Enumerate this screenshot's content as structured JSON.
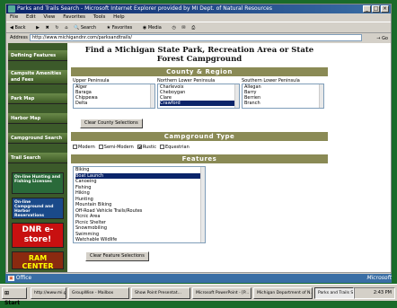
{
  "window": {
    "title": "Parks and Trails Search - Microsoft Internet Explorer provided by MI Dept. of Natural Resources"
  },
  "menu": [
    "File",
    "Edit",
    "View",
    "Favorites",
    "Tools",
    "Help"
  ],
  "toolbar": {
    "back": "Back",
    "search": "Search",
    "favorites": "Favorites",
    "media": "Media"
  },
  "address": {
    "label": "Address",
    "url": "http://www.michigandnr.com/parksandtrails/",
    "go": "Go"
  },
  "sidebar": {
    "items": [
      {
        "label": "Defining Features"
      },
      {
        "label": "Campsite Amenities and Fees"
      },
      {
        "label": "Park Map"
      },
      {
        "label": "Harbor Map"
      },
      {
        "label": "Campground Search"
      },
      {
        "label": "Trail Search"
      }
    ],
    "promos": [
      {
        "label": "On-line Hunting and Fishing Licenses"
      },
      {
        "label": "On-line Campground and Harbor Reservations"
      },
      {
        "label": "DNR e-store!"
      },
      {
        "label": "RAM CENTER"
      }
    ]
  },
  "main": {
    "title": "Find a Michigan State Park, Recreation Area or State Forest Campground",
    "county_header": "County & Region",
    "columns": [
      {
        "header": "Upper Peninsula",
        "items": [
          "Alger",
          "Baraga",
          "Chippewa",
          "Delta"
        ],
        "selected": -1
      },
      {
        "header": "Northern Lower Peninsula",
        "items": [
          "Charlevoix",
          "Cheboygan",
          "Clare",
          "Crawford"
        ],
        "selected": 3
      },
      {
        "header": "Southern Lower Peninsula",
        "items": [
          "Allegan",
          "Barry",
          "Berrien",
          "Branch"
        ],
        "selected": -1
      }
    ],
    "clear_county": "Clear County Selections",
    "type_header": "Campground Type",
    "types": [
      {
        "label": "Modern",
        "checked": false
      },
      {
        "label": "Semi-Modern",
        "checked": false
      },
      {
        "label": "Rustic",
        "checked": true
      },
      {
        "label": "Equestrian",
        "checked": false
      }
    ],
    "feature_header": "Features",
    "features": [
      "Biking",
      "Boat Launch",
      "Canoeing",
      "Fishing",
      "Hiking",
      "Hunting",
      "Mountain Biking",
      "Off-Road Vehicle Trails/Routes",
      "Picnic Area",
      "Picnic Shelter",
      "Snowmobiling",
      "Swimming",
      "Watchable Wildlife"
    ],
    "feature_selected": 1,
    "clear_features": "Clear Feature Selections"
  },
  "office_bar": {
    "label": "Office"
  },
  "taskbar": {
    "start": "Start",
    "tasks": [
      {
        "label": "http://www.mi.gov..."
      },
      {
        "label": "GroupWise - Mailbox"
      },
      {
        "label": "Show Point Presentat..."
      },
      {
        "label": "Microsoft PowerPoint - [P..."
      },
      {
        "label": "Michigan Department of N..."
      },
      {
        "label": "Parks and Trails Searc..."
      }
    ],
    "active_task": 5,
    "clock": "2:43 PM"
  },
  "brand": "Microsoft"
}
